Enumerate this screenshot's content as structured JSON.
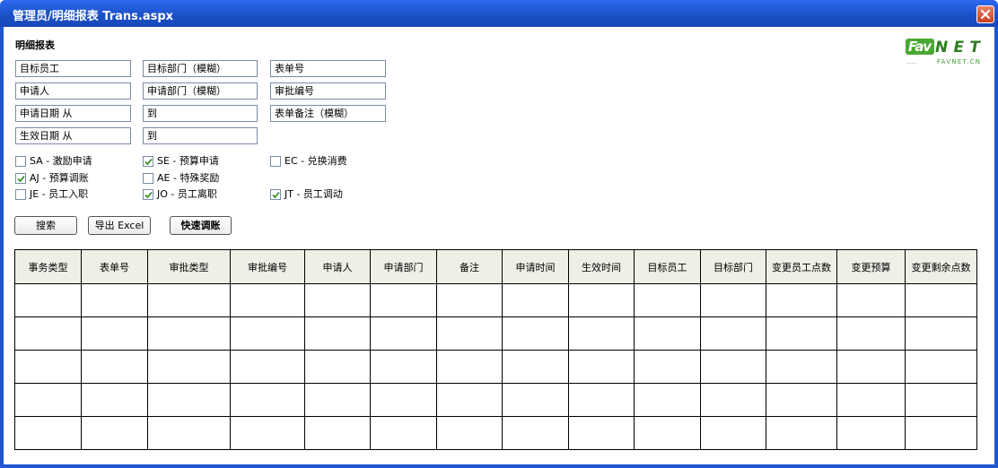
{
  "window": {
    "title": "管理员/明细报表 Trans.aspx"
  },
  "section_title": "明细报表",
  "logo": {
    "main": "FavNET",
    "sub": "FAVNET.CN",
    "dots": "......"
  },
  "fields": [
    [
      "目标员工",
      "目标部门（模糊）",
      "表单号"
    ],
    [
      "申请人",
      "申请部门（模糊）",
      "审批编号"
    ],
    [
      "申请日期 从",
      "到",
      "表单备注（模糊）"
    ],
    [
      "生效日期 从",
      "到"
    ]
  ],
  "checkboxes": [
    [
      {
        "label": "SA - 激励申请",
        "checked": false
      },
      {
        "label": "SE - 预算申请",
        "checked": true
      },
      {
        "label": "EC - 兑换消费",
        "checked": false
      }
    ],
    [
      {
        "label": "AJ - 预算调账",
        "checked": true
      },
      {
        "label": "AE - 特殊奖励",
        "checked": false
      }
    ],
    [
      {
        "label": "JE - 员工入职",
        "checked": false
      },
      {
        "label": "JO - 员工离职",
        "checked": true
      },
      {
        "label": "JT - 员工调动",
        "checked": true
      }
    ]
  ],
  "buttons": {
    "search": "搜索",
    "export": "导出 Excel",
    "quick_adjust": "快速调账"
  },
  "table": {
    "columns": [
      "事务类型",
      "表单号",
      "审批类型",
      "审批编号",
      "申请人",
      "申请部门",
      "备注",
      "申请时间",
      "生效时间",
      "目标员工",
      "目标部门",
      "变更员工点数",
      "变更预算",
      "变更剩余点数"
    ],
    "empty_rows": 5
  },
  "colors": {
    "title_bar": "#1f56cf",
    "header_bg": "#efefe6",
    "logo_green": "#3d9a2e"
  }
}
